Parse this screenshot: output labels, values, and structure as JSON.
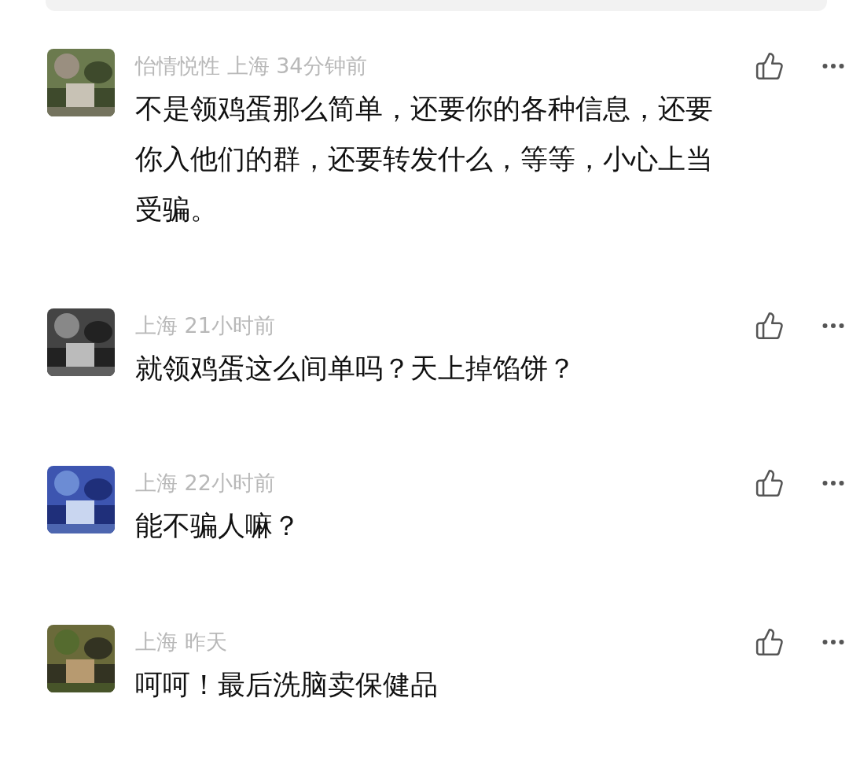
{
  "comments": [
    {
      "meta": "怡情悦性 上海 34分钟前",
      "text": "不是领鸡蛋那么简单，还要你的各种信息，还要你入他们的群，还要转发什么，等等，小心上当受骗。"
    },
    {
      "meta": "上海 21小时前",
      "text": "就领鸡蛋这么间单吗？天上掉馅饼？"
    },
    {
      "meta": "上海 22小时前",
      "text": "能不骗人嘛？"
    },
    {
      "meta": "上海 昨天",
      "text": "呵呵！最后洗脑卖保健品"
    }
  ]
}
